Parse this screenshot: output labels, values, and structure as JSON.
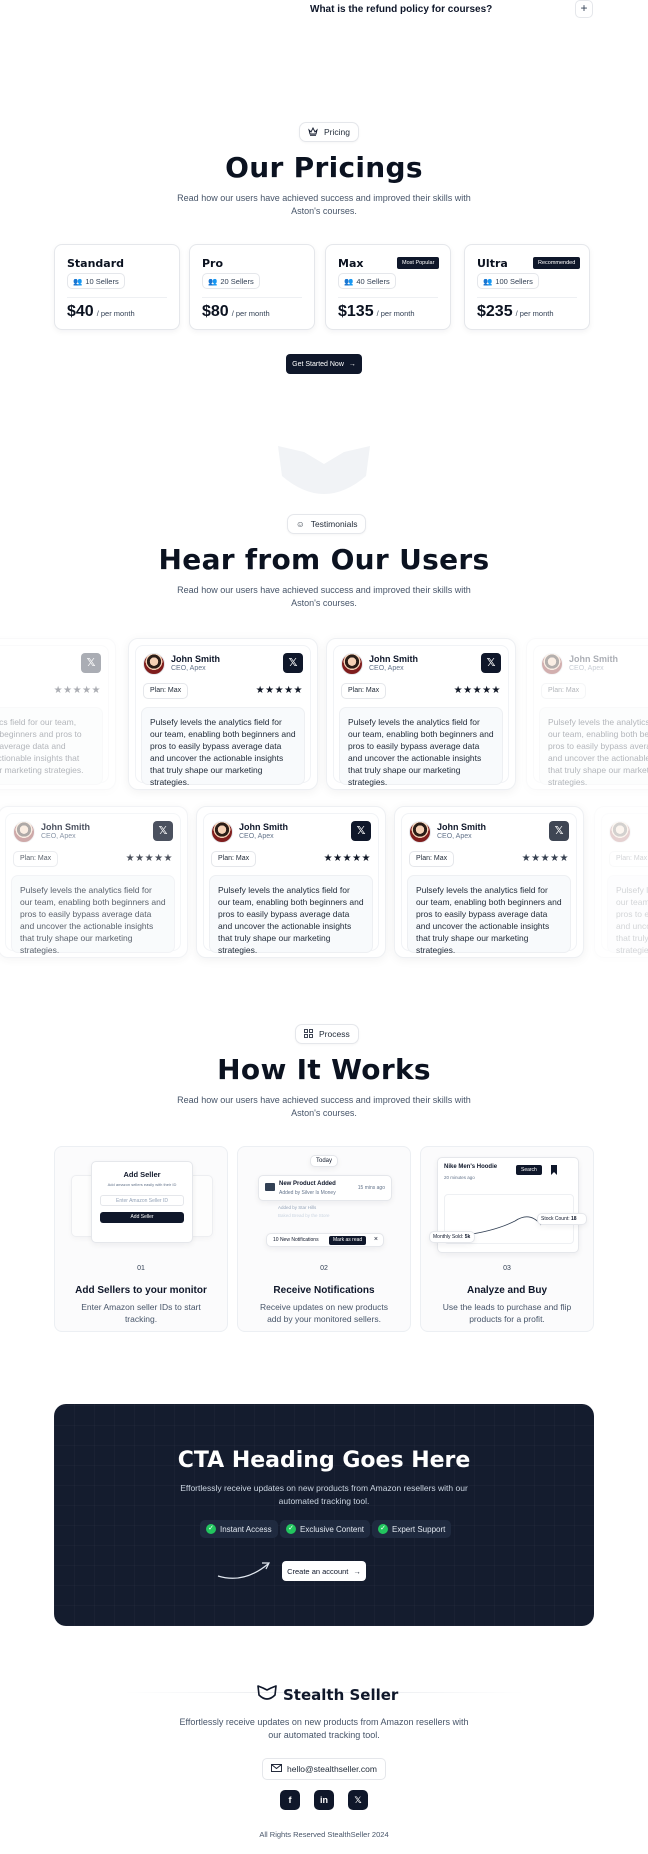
{
  "faq": {
    "question": "What is the refund policy for courses?",
    "toggle": "+"
  },
  "pricing": {
    "badge": "Pricing",
    "title": "Our Pricings",
    "subtitle": "Read how our users have achieved success and improved their skills with Aston's courses.",
    "per_label": "/ per month",
    "plans": [
      {
        "name": "Standard",
        "sellers": "10 Sellers",
        "price": "$40",
        "tag": ""
      },
      {
        "name": "Pro",
        "sellers": "20 Sellers",
        "price": "$80",
        "tag": ""
      },
      {
        "name": "Max",
        "sellers": "40 Sellers",
        "price": "$135",
        "tag": "Most Popular"
      },
      {
        "name": "Ultra",
        "sellers": "100 Sellers",
        "price": "$235",
        "tag": "Recommended"
      }
    ],
    "cta": "Get Started Now"
  },
  "testimonials": {
    "badge": "Testimonials",
    "title": "Hear from Our Users",
    "subtitle": "Read how our users have achieved success and improved their skills with Aston's courses.",
    "name": "John Smith",
    "role": "CEO, Apex",
    "plan": "Plan: Max",
    "stars": "★★★★★",
    "quote": "Pulsefy levels the analytics field for our team, enabling both beginners and pros to easily bypass average data and uncover the actionable insights that truly shape our marketing strategies.",
    "quote_partial": "the analytics field for our oth beginners and pros average data and onable insights that truly g strategies.",
    "x_icon": "𝕏"
  },
  "process": {
    "badge": "Process",
    "title": "How It Works",
    "subtitle": "Read how our users have achieved success and improved their skills with Aston's courses.",
    "steps": [
      {
        "num": "01",
        "title": "Add Sellers to your monitor",
        "desc": "Enter Amazon seller IDs to start tracking."
      },
      {
        "num": "02",
        "title": "Receive Notifications",
        "desc": "Receive updates on new products add by your monitored sellers."
      },
      {
        "num": "03",
        "title": "Analyze and Buy",
        "desc": "Use the leads to purchase and flip products for a profit."
      }
    ],
    "mock1": {
      "title": "Add Seller",
      "hint": "Add amazon sellers easily with their ID",
      "placeholder": "Enter Amazon Seller ID",
      "button": "Add Seller"
    },
    "mock2": {
      "today": "Today",
      "title": "New Product Added",
      "by": "Added by Silver Is Money",
      "time": "15 mins ago",
      "row2": "Added by Star Hills",
      "row3": "Baked Bread by the Store",
      "notif": "10 New Notifications",
      "mark": "Mark as read"
    },
    "mock3": {
      "product": "Nike Men's Hoodie",
      "time": "20 minutes ago",
      "search": "Search",
      "stock_label": "Stock Count:",
      "stock_val": "18",
      "sold_label": "Monthly Sold:",
      "sold_val": "5k"
    }
  },
  "cta": {
    "title": "CTA Heading Goes Here",
    "subtitle": "Effortlessly receive updates on new products from Amazon resellers with our automated tracking tool.",
    "chips": [
      "Instant Access",
      "Exclusive Content",
      "Expert Support"
    ],
    "button": "Create an account"
  },
  "footer": {
    "brand": "Stealth Seller",
    "tagline": "Effortlessly receive updates on new products from Amazon resellers with our automated tracking tool.",
    "email": "hello@stealthseller.com",
    "copyright": "All Rights Reserved StealthSeller 2024"
  }
}
